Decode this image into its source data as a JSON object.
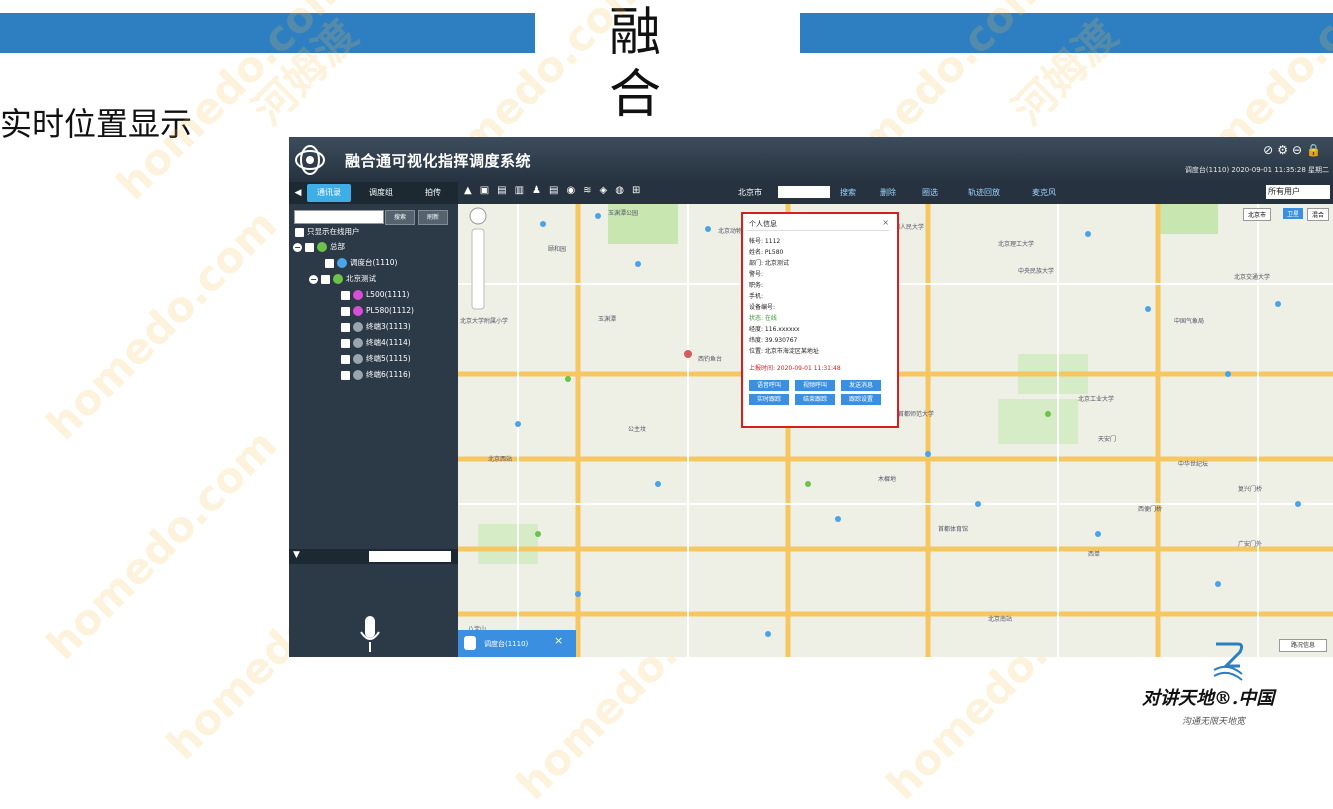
{
  "slide": {
    "title": "融合",
    "subtitle": "实时位置显示",
    "accent_color": "#2d7fc1"
  },
  "watermark": {
    "text_latin": "homedo.com",
    "text_cn": "河姆渡"
  },
  "app": {
    "name": "融合通可视化指挥调度系统",
    "status_line": "调度台(1110) 2020-09-01 11:35:28 星期二",
    "header_icons": [
      "mute-icon",
      "gear-icon",
      "minus-icon",
      "lock-icon"
    ],
    "sidebar": {
      "tabs": [
        "通讯录",
        "调度组",
        "拍传"
      ],
      "search_button": "搜索",
      "refresh_button": "刷新",
      "online_only_label": "只显示在线用户",
      "tree": [
        {
          "label": "总部",
          "level": 0
        },
        {
          "label": "调度台(1110)",
          "level": 1
        },
        {
          "label": "北京测试",
          "level": 0
        },
        {
          "label": "L500(1111)",
          "level": 2
        },
        {
          "label": "PL580(1112)",
          "level": 2
        },
        {
          "label": "终端3(1113)",
          "level": 2
        },
        {
          "label": "终端4(1114)",
          "level": 2
        },
        {
          "label": "终端5(1115)",
          "level": 2
        },
        {
          "label": "终端6(1116)",
          "level": 2
        }
      ]
    },
    "map_toolbar": {
      "city": "北京市",
      "search": "搜索",
      "delete": "删除",
      "circle_select": "圈选",
      "track_playback": "轨迹回放",
      "microphone": "麦克风",
      "user_filter": "所有用户"
    },
    "map": {
      "labels": [
        "北京市",
        "卫星",
        "混合",
        "玉渊潭公园",
        "中国人民大学",
        "北京理工大学",
        "北京交通大学",
        "中央民族大学",
        "中国气象局",
        "北京大学附属小学",
        "颐和园",
        "西钓鱼台",
        "天安门",
        "北京西站",
        "首都师范大学",
        "西便门桥",
        "广安门外",
        "北京工业大学",
        "北京动物园",
        "首都体育馆",
        "复兴门桥",
        "中华世纪坛",
        "西单",
        "北京南站",
        "木樨地",
        "公主坟",
        "玉渊潭",
        "八宝山"
      ],
      "legend": "路况信息"
    },
    "popup": {
      "title": "个人信息",
      "close": "×",
      "fields": [
        "帐号: 1112",
        "姓名: PL580",
        "部门: 北京测试",
        "警号:",
        "职务:",
        "手机:",
        "设备编号:",
        "状态: 在线",
        "经度: 116.xxxxxx",
        "纬度: 39.930767",
        "位置: 北京市海淀区某地址"
      ],
      "report_time": "上报时间: 2020-09-01 11:31:48",
      "buttons": [
        "语音呼叫",
        "视频呼叫",
        "发送消息",
        "实时跟踪",
        "结束跟踪",
        "跟踪设置"
      ]
    },
    "bottom_tab": "调度台(1110)"
  },
  "brand": {
    "name": "对讲天地®.中国",
    "slogan": "沟通无限天地宽"
  }
}
